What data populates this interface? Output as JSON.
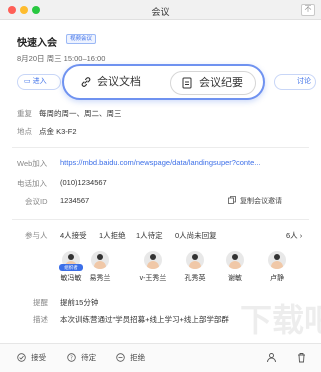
{
  "window": {
    "title": "会议",
    "pin_label": "不"
  },
  "meeting": {
    "title": "快速入会",
    "badge": "视频会议",
    "time": "8月20日 周三 15:00–16:00"
  },
  "tabs": {
    "enter": "进入",
    "discuss": "讨论"
  },
  "doc_bubble": {
    "doc_label": "会议文档",
    "summary_label": "会议纪要"
  },
  "info": {
    "repeat_label": "重复",
    "repeat_value": "每周的周一、周二、周三",
    "location_label": "地点",
    "location_value": "点金 K3-F2",
    "web_label": "Web加入",
    "web_value": "https://mbd.baidu.com/newspage/data/landingsuper?conte...",
    "phone_label": "电话加入",
    "phone_value": "(010)1234567",
    "meeting_id_label": "会议ID",
    "meeting_id_value": "1234567",
    "copy_invite": "复制会议邀请"
  },
  "participants": {
    "label": "参与人",
    "accepted": "4人接受",
    "declined": "1人拒绝",
    "tentative": "1人待定",
    "no_reply": "0人尚未回复",
    "count": "6人 ›",
    "organizer_tag": "组织者",
    "people": [
      {
        "name": "敏冯敏"
      },
      {
        "name": "易秀兰"
      },
      {
        "name": "v-王秀兰"
      },
      {
        "name": "孔秀英"
      },
      {
        "name": "谢敏"
      },
      {
        "name": "卢静"
      }
    ]
  },
  "reminder": {
    "label": "提醒",
    "value": "提前15分钟"
  },
  "description": {
    "label": "描述",
    "value": "本次训练营通过\"学员招募+线上学习+线上部学部群"
  },
  "responses": {
    "accept": "接受",
    "tentative": "待定",
    "decline": "拒绝"
  },
  "watermark": "下载吧",
  "colors": {
    "accent": "#3c6fe8",
    "bubble_border": "#6f92f0"
  }
}
